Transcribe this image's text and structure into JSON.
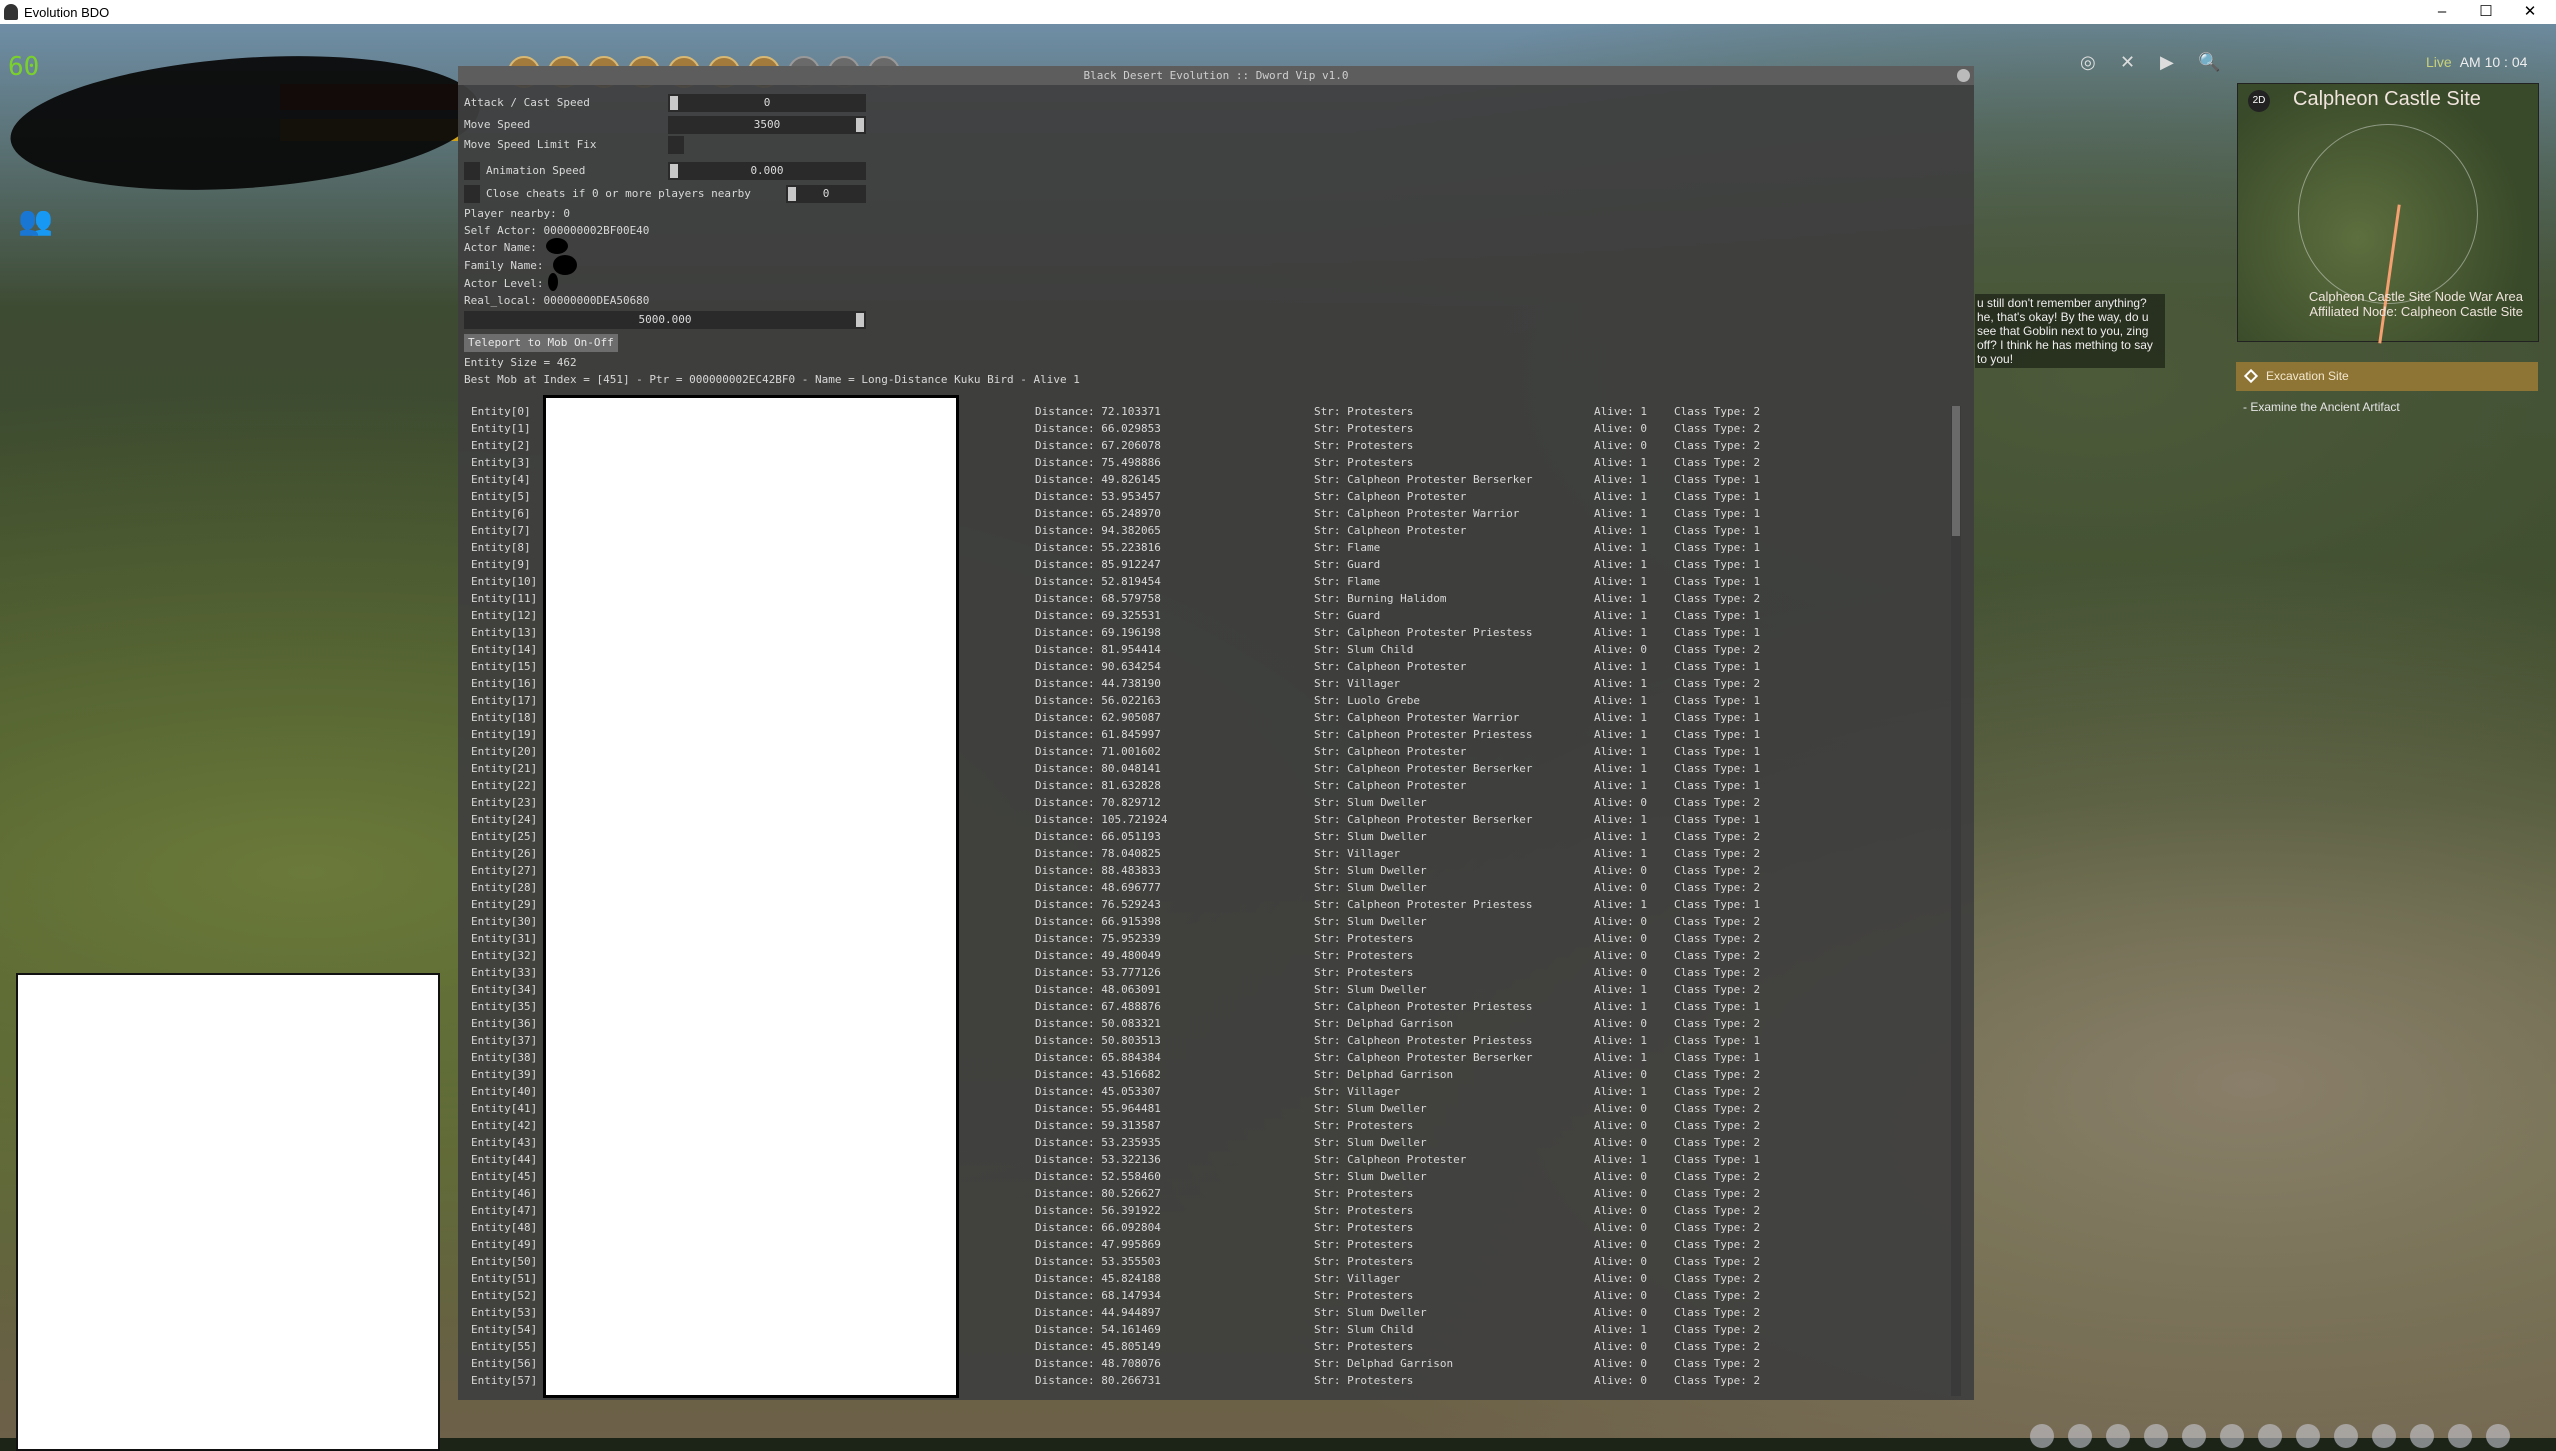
{
  "window": {
    "title": "Evolution BDO",
    "minimize": "–",
    "maximize": "☐",
    "close": "✕"
  },
  "hud": {
    "fps": "60",
    "party_icon": "party-icon",
    "live": "Live",
    "time": "AM 10 : 04",
    "toolbar_icons": [
      "inventory",
      "search",
      "alchemy",
      "exp-buff",
      "bell",
      "pet",
      "drop-buff",
      "skill-tree",
      "palette",
      "guide"
    ],
    "top_right_icons": [
      "horse",
      "crossed-swords",
      "play",
      "search"
    ]
  },
  "minimap": {
    "mode": "2D",
    "title": "Calpheon Castle Site",
    "node_line1": "Calpheon Castle Site Node War Area",
    "node_line2": "Affiliated Node: Calpheon Castle Site"
  },
  "quest": {
    "title": "Excavation Site",
    "objective": "- Examine the Ancient Artifact"
  },
  "dialog": {
    "text": "u still don't remember anything? he, that's okay! By the way, do u see that Goblin next to you, zing off? I think he has mething to say to you!"
  },
  "cheat": {
    "title": "Black Desert Evolution :: Dword Vip v1.0",
    "attack_label": "Attack / Cast Speed",
    "attack_value": "0",
    "move_label": "Move Speed",
    "move_value": "3500",
    "limit_label": "Move Speed Limit Fix",
    "anim_label": "Animation Speed",
    "anim_value": "0.000",
    "close_label": "Close cheats if 0 or more players nearby",
    "close_value": "0",
    "player_nearby": "Player nearby: 0",
    "self_actor": "Self Actor: 000000002BF00E40",
    "actor_name": "Actor Name:",
    "family_name": "Family Name:",
    "actor_level": "Actor Level:",
    "real_local": "Real_local: 00000000DEA50680",
    "range_value": "5000.000",
    "teleport_button": "Teleport to Mob On-Off",
    "entity_size": "Entity Size = 462",
    "best_mob": "Best Mob at Index = [451] - Ptr = 000000002EC42BF0 - Name = Long-Distance Kuku Bird - Alive 1"
  },
  "entities": [
    [
      "72.103371",
      "Protesters",
      "1",
      "2"
    ],
    [
      "66.029853",
      "Protesters",
      "0",
      "2"
    ],
    [
      "67.206078",
      "Protesters",
      "0",
      "2"
    ],
    [
      "75.498886",
      "Protesters",
      "1",
      "2"
    ],
    [
      "49.826145",
      "Calpheon Protester Berserker",
      "1",
      "1"
    ],
    [
      "53.953457",
      "Calpheon Protester",
      "1",
      "1"
    ],
    [
      "65.248970",
      "Calpheon Protester Warrior",
      "1",
      "1"
    ],
    [
      "94.382065",
      "Calpheon Protester",
      "1",
      "1"
    ],
    [
      "55.223816",
      "Flame",
      "1",
      "1"
    ],
    [
      "85.912247",
      "Guard",
      "1",
      "1"
    ],
    [
      "52.819454",
      "Flame",
      "1",
      "1"
    ],
    [
      "68.579758",
      "Burning Halidom",
      "1",
      "2"
    ],
    [
      "69.325531",
      "Guard",
      "1",
      "1"
    ],
    [
      "69.196198",
      "Calpheon Protester Priestess",
      "1",
      "1"
    ],
    [
      "81.954414",
      "Slum Child",
      "0",
      "2"
    ],
    [
      "90.634254",
      "Calpheon Protester",
      "1",
      "1"
    ],
    [
      "44.738190",
      "Villager",
      "1",
      "2"
    ],
    [
      "56.022163",
      "Luolo Grebe",
      "1",
      "1"
    ],
    [
      "62.905087",
      "Calpheon Protester Warrior",
      "1",
      "1"
    ],
    [
      "61.845997",
      "Calpheon Protester Priestess",
      "1",
      "1"
    ],
    [
      "71.001602",
      "Calpheon Protester",
      "1",
      "1"
    ],
    [
      "80.048141",
      "Calpheon Protester Berserker",
      "1",
      "1"
    ],
    [
      "81.632828",
      "Calpheon Protester",
      "1",
      "1"
    ],
    [
      "70.829712",
      "Slum Dweller",
      "0",
      "2"
    ],
    [
      "105.721924",
      "Calpheon Protester Berserker",
      "1",
      "1"
    ],
    [
      "66.051193",
      "Slum Dweller",
      "1",
      "2"
    ],
    [
      "78.040825",
      "Villager",
      "1",
      "2"
    ],
    [
      "88.483833",
      "Slum Dweller",
      "0",
      "2"
    ],
    [
      "48.696777",
      "Slum Dweller",
      "0",
      "2"
    ],
    [
      "76.529243",
      "Calpheon Protester Priestess",
      "1",
      "1"
    ],
    [
      "66.915398",
      "Slum Dweller",
      "0",
      "2"
    ],
    [
      "75.952339",
      "Protesters",
      "0",
      "2"
    ],
    [
      "49.480049",
      "Protesters",
      "0",
      "2"
    ],
    [
      "53.777126",
      "Protesters",
      "0",
      "2"
    ],
    [
      "48.063091",
      "Slum Dweller",
      "1",
      "2"
    ],
    [
      "67.488876",
      "Calpheon Protester Priestess",
      "1",
      "1"
    ],
    [
      "50.083321",
      "Delphad Garrison",
      "0",
      "2"
    ],
    [
      "50.803513",
      "Calpheon Protester Priestess",
      "1",
      "1"
    ],
    [
      "65.884384",
      "Calpheon Protester Berserker",
      "1",
      "1"
    ],
    [
      "43.516682",
      "Delphad Garrison",
      "0",
      "2"
    ],
    [
      "45.053307",
      "Villager",
      "1",
      "2"
    ],
    [
      "55.964481",
      "Slum Dweller",
      "0",
      "2"
    ],
    [
      "59.313587",
      "Protesters",
      "0",
      "2"
    ],
    [
      "53.235935",
      "Slum Dweller",
      "0",
      "2"
    ],
    [
      "53.322136",
      "Calpheon Protester",
      "1",
      "1"
    ],
    [
      "52.558460",
      "Slum Dweller",
      "0",
      "2"
    ],
    [
      "80.526627",
      "Protesters",
      "0",
      "2"
    ],
    [
      "56.391922",
      "Protesters",
      "0",
      "2"
    ],
    [
      "66.092804",
      "Protesters",
      "0",
      "2"
    ],
    [
      "47.995869",
      "Protesters",
      "0",
      "2"
    ],
    [
      "53.355503",
      "Protesters",
      "0",
      "2"
    ],
    [
      "45.824188",
      "Villager",
      "0",
      "2"
    ],
    [
      "68.147934",
      "Protesters",
      "0",
      "2"
    ],
    [
      "44.944897",
      "Slum Dweller",
      "0",
      "2"
    ],
    [
      "54.161469",
      "Slum Child",
      "1",
      "2"
    ],
    [
      "45.805149",
      "Protesters",
      "0",
      "2"
    ],
    [
      "48.708076",
      "Delphad Garrison",
      "0",
      "2"
    ],
    [
      "80.266731",
      "Protesters",
      "0",
      "2"
    ]
  ]
}
